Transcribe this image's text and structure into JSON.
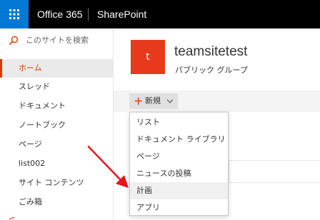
{
  "suite_bar": {
    "app_name": "Office 365",
    "site_link": "SharePoint",
    "waffle_icon": "waffle-icon",
    "color": "#000000",
    "accent": "#0078d4"
  },
  "left_nav": {
    "search_placeholder": "このサイトを検索",
    "items": [
      {
        "label": "ホーム",
        "active": true
      },
      {
        "label": "スレッド"
      },
      {
        "label": "ドキュメント"
      },
      {
        "label": "ノートブック"
      },
      {
        "label": "ページ"
      },
      {
        "label": "list002"
      },
      {
        "label": "サイト コンテンツ"
      },
      {
        "label": "ごみ箱"
      }
    ],
    "active_color": "#d83b01"
  },
  "site_header": {
    "logo_letter": "t",
    "logo_color": "#e8391c",
    "title": "teamsitetest",
    "subtitle": "パブリック グループ"
  },
  "command_bar": {
    "new_label": "新規"
  },
  "new_menu": {
    "items": [
      {
        "label": "リスト"
      },
      {
        "label": "ドキュメント ライブラリ"
      },
      {
        "label": "ページ"
      },
      {
        "label": "ニュースの投稿"
      },
      {
        "label": "計画",
        "hovered": true
      },
      {
        "label": "アプリ"
      }
    ]
  },
  "annotation": {
    "arrow_color": "#e8131b",
    "points_to": "計画"
  }
}
